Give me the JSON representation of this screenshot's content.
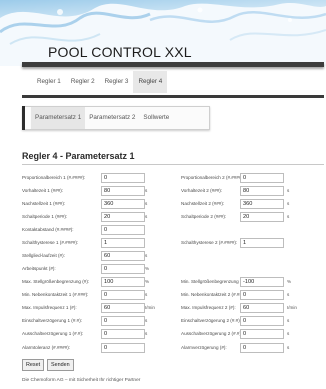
{
  "app": {
    "title": "POOL CONTROL XXL"
  },
  "main_tabs": [
    "Regler 1",
    "Regler 2",
    "Regler 3",
    "Regler 4"
  ],
  "sub_tabs": [
    "Parametersatz 1",
    "Parametersatz 2",
    "Sollwerte"
  ],
  "section": {
    "title": "Regler 4 - Parametersatz 1"
  },
  "left_fields": [
    {
      "label": "Proportionalbereich 1 (#.####):",
      "value": "0",
      "unit": ""
    },
    {
      "label": "Vorhaltezeit 1 (###):",
      "value": "80",
      "unit": "s"
    },
    {
      "label": "Nachstellzeit 1 (###):",
      "value": "360",
      "unit": "s"
    },
    {
      "label": "Schaltperiode 1 (###):",
      "value": "20",
      "unit": "s"
    },
    {
      "label": "Kontaktabstand (#.####):",
      "value": "0",
      "unit": ""
    },
    {
      "label": "Schalthysterese 1 (#.####):",
      "value": "1",
      "unit": ""
    },
    {
      "label": "Stellglied-laufzeit (#):",
      "value": "60",
      "unit": "s"
    },
    {
      "label": "Arbeitspunkt (#):",
      "value": "0",
      "unit": "%"
    },
    {
      "label": "Max. Stellgrößenbegrenzung (#):",
      "value": "100",
      "unit": "%"
    },
    {
      "label": "Min. Nebenkontaktzeit 1 (#.###):",
      "value": "0",
      "unit": "s"
    },
    {
      "label": "Max. Impulsfrequenz 1 (#):",
      "value": "60",
      "unit": "I/min"
    },
    {
      "label": "Einschaltverzögerung 1 (#.#):",
      "value": "0",
      "unit": "s"
    },
    {
      "label": "Ausschaltverzögerung 1 (#.#):",
      "value": "0",
      "unit": "s"
    },
    {
      "label": "Alarmtoleranz (#.####):",
      "value": "0",
      "unit": ""
    }
  ],
  "right_fields": [
    {
      "label": "Proportionalbereich 2 (#.####):",
      "value": "0",
      "unit": "",
      "row": 0
    },
    {
      "label": "Vorhaltezeit 2 (###):",
      "value": "80",
      "unit": "s",
      "row": 1
    },
    {
      "label": "Nachstellzeit 2 (###):",
      "value": "360",
      "unit": "s",
      "row": 2
    },
    {
      "label": "Schaltperiode 2 (###):",
      "value": "20",
      "unit": "s",
      "row": 3
    },
    {
      "label": "Schalthysterese 2 (#.####):",
      "value": "1",
      "unit": "",
      "row": 5
    },
    {
      "label": "Min. Stellgrößenbegrenzung (#):",
      "value": "-100",
      "unit": "%",
      "row": 8
    },
    {
      "label": "Min. Nebenkontaktzeit 2 (#.###):",
      "value": "0",
      "unit": "s",
      "row": 9
    },
    {
      "label": "Max. Impulsfrequenz 2 (#):",
      "value": "60",
      "unit": "I/min",
      "row": 10
    },
    {
      "label": "Einschaltverzögerung 2 (#.#):",
      "value": "0",
      "unit": "s",
      "row": 11
    },
    {
      "label": "Ausschaltverzögerung 2 (#.#):",
      "value": "0",
      "unit": "s",
      "row": 12
    },
    {
      "label": "Alarmverzögerung (#):",
      "value": "0",
      "unit": "s",
      "row": 13
    }
  ],
  "buttons": {
    "reset": "Reset",
    "send": "Senden"
  },
  "footer": {
    "text": "Die Chemoform AG – mit Sicherheit Ihr richtiger Partner"
  },
  "colors": {
    "header_bar": "#3d3d3d",
    "active_tab": "#e8e8e8",
    "swirl": "#7fb6dd"
  }
}
